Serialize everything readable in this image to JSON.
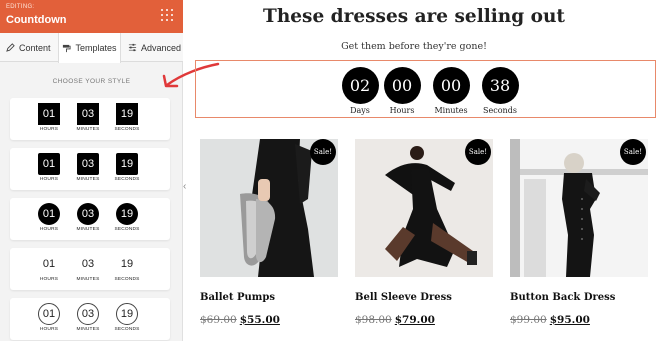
{
  "sidebar": {
    "editing_label": "EDITING:",
    "editing_title": "Countdown",
    "tabs": [
      {
        "label": "Content",
        "icon": "pencil-icon"
      },
      {
        "label": "Templates",
        "icon": "paint-roller-icon"
      },
      {
        "label": "Advanced",
        "icon": "sliders-icon"
      }
    ],
    "choose_style": "CHOOSE YOUR STYLE",
    "templates": [
      {
        "style": "square",
        "values": [
          "01",
          "03",
          "19"
        ],
        "labels": [
          "HOURS",
          "MINUTES",
          "SECONDS"
        ]
      },
      {
        "style": "square-rounded",
        "values": [
          "01",
          "03",
          "19"
        ],
        "labels": [
          "HOURS",
          "MINUTES",
          "SECONDS"
        ]
      },
      {
        "style": "circle-filled",
        "values": [
          "01",
          "03",
          "19"
        ],
        "labels": [
          "HOURS",
          "MINUTES",
          "SECONDS"
        ]
      },
      {
        "style": "plain",
        "values": [
          "01",
          "03",
          "19"
        ],
        "labels": [
          "HOURS",
          "MINUTES",
          "SECONDS"
        ]
      },
      {
        "style": "circle-outline",
        "values": [
          "01",
          "03",
          "19"
        ],
        "labels": [
          "HOURS",
          "MINUTES",
          "SECONDS"
        ]
      }
    ],
    "collapse_glyph": "‹"
  },
  "main": {
    "headline": "These dresses are selling out",
    "subheadline": "Get them before they're gone!",
    "countdown": [
      {
        "value": "02",
        "label": "Days"
      },
      {
        "value": "00",
        "label": "Hours"
      },
      {
        "value": "00",
        "label": "Minutes"
      },
      {
        "value": "38",
        "label": "Seconds"
      }
    ],
    "products": [
      {
        "name": "Ballet Pumps",
        "old_price": "$69.00",
        "new_price": "$55.00",
        "badge": "Sale!"
      },
      {
        "name": "Bell Sleeve Dress",
        "old_price": "$98.00",
        "new_price": "$79.00",
        "badge": "Sale!"
      },
      {
        "name": "Button Back Dress",
        "old_price": "$99.00",
        "new_price": "$95.00",
        "badge": "Sale!"
      }
    ]
  },
  "colors": {
    "accent": "#e2603a",
    "countdown_border": "#e8896a",
    "arrow": "#e0393a"
  }
}
